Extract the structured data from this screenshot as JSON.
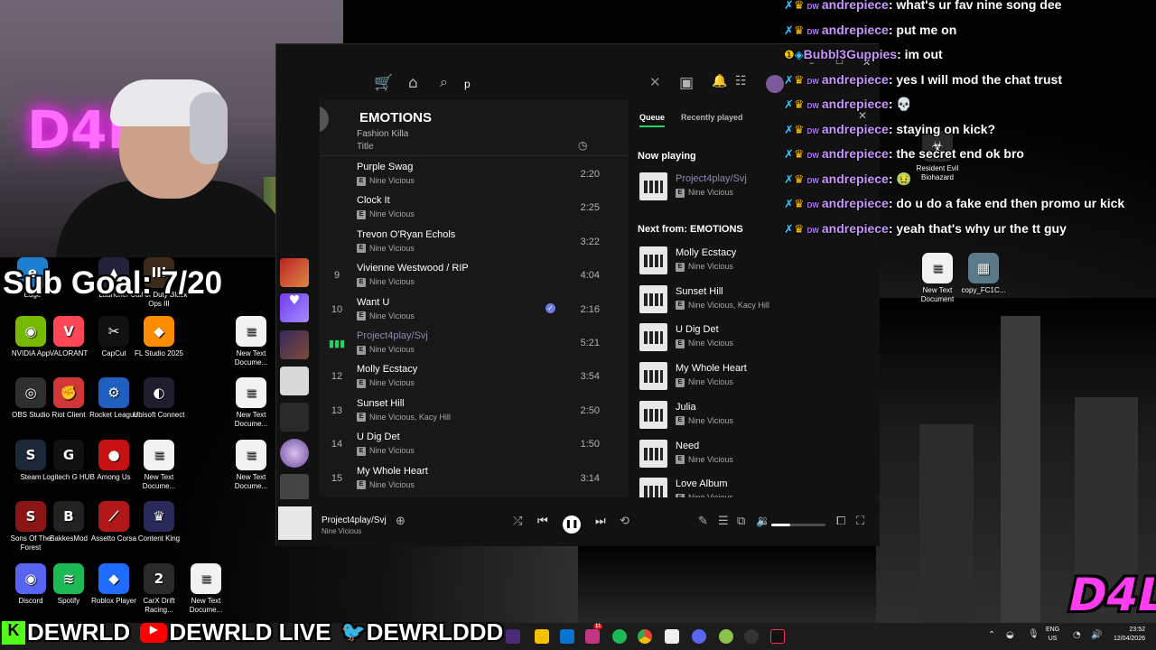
{
  "overlay": {
    "sub_goal": "Sub Goal: 7/20",
    "brand_logo": "D4L",
    "socials": [
      "DEWRLD",
      "DEWRLD LIVE",
      "DEWRLDDD"
    ]
  },
  "desktop_icons": [
    {
      "label": "Edge",
      "glyph": "e",
      "color": "#1b7ecf"
    },
    {
      "label": "Launcher",
      "glyph": "▲",
      "color": "#22223a"
    },
    {
      "label": "Call of Duty Black Ops III",
      "glyph": "III",
      "color": "#3a2a1a"
    },
    {
      "label": "NVIDIA App",
      "glyph": "◉",
      "color": "#76b900"
    },
    {
      "label": "VALORANT",
      "glyph": "V",
      "color": "#ff4655"
    },
    {
      "label": "CapCut",
      "glyph": "✂",
      "color": "#111111"
    },
    {
      "label": "FL Studio 2025",
      "glyph": "◆",
      "color": "#ff8c00"
    },
    {
      "label": "New Text Docume...",
      "glyph": "≡",
      "color": "#f2f2f2"
    },
    {
      "label": "OBS Studio",
      "glyph": "◎",
      "color": "#302e31"
    },
    {
      "label": "Riot Client",
      "glyph": "✊",
      "color": "#d13639"
    },
    {
      "label": "Rocket League",
      "glyph": "⚙",
      "color": "#1f5fbf"
    },
    {
      "label": "Ubisoft Connect",
      "glyph": "◐",
      "color": "#1e1e2e"
    },
    {
      "label": "New Text Docume...",
      "glyph": "≡",
      "color": "#f2f2f2"
    },
    {
      "label": "Steam",
      "glyph": "S",
      "color": "#1b2838"
    },
    {
      "label": "Logitech G HUB",
      "glyph": "G",
      "color": "#111111"
    },
    {
      "label": "Among Us",
      "glyph": "●",
      "color": "#c51111"
    },
    {
      "label": "New Text Docume...",
      "glyph": "≡",
      "color": "#f2f2f2"
    },
    {
      "label": "New Text Docume...",
      "glyph": "≡",
      "color": "#f2f2f2"
    },
    {
      "label": "Sons Of The Forest",
      "glyph": "S",
      "color": "#8b1414"
    },
    {
      "label": "BakkesMod",
      "glyph": "B",
      "color": "#222222"
    },
    {
      "label": "Assetto Corsa",
      "glyph": "⟋",
      "color": "#b01818"
    },
    {
      "label": "Content King",
      "glyph": "♛",
      "color": "#2a2a5a"
    },
    {
      "label": "Discord",
      "glyph": "◉",
      "color": "#5865f2"
    },
    {
      "label": "Spotify",
      "glyph": "≋",
      "color": "#1db954"
    },
    {
      "label": "Roblox Player",
      "glyph": "◆",
      "color": "#1e6cff"
    },
    {
      "label": "CarX Drift Racing...",
      "glyph": "2",
      "color": "#2a2a2a"
    },
    {
      "label": "New Text Docume...",
      "glyph": "≡",
      "color": "#f2f2f2"
    },
    {
      "label": "Resident Evil Biohazard",
      "glyph": "☣",
      "color": "#2a2a2a"
    },
    {
      "label": "New Text Document",
      "glyph": "≡",
      "color": "#f2f2f2"
    },
    {
      "label": "copy_FC1C...",
      "glyph": "▦",
      "color": "#5a7a8a"
    }
  ],
  "spotify": {
    "search_value": "p",
    "playlist_title": "EMOTIONS",
    "playlist_subtitle": "Fashion Killa",
    "column_title": "Title",
    "tracks": [
      {
        "num": "",
        "title": "Purple Swag",
        "artist": "Nine Vicious",
        "duration": "2:20",
        "playing": false,
        "liked": false
      },
      {
        "num": "",
        "title": "Clock It",
        "artist": "Nine Vicious",
        "duration": "2:25",
        "playing": false,
        "liked": false
      },
      {
        "num": "",
        "title": "Trevon O'Ryan Echols",
        "artist": "Nine Vicious",
        "duration": "3:22",
        "playing": false,
        "liked": false
      },
      {
        "num": "9",
        "title": "Vivienne Westwood / RIP",
        "artist": "Nine Vicious",
        "duration": "4:04",
        "playing": false,
        "liked": false
      },
      {
        "num": "10",
        "title": "Want U",
        "artist": "Nine Vicious",
        "duration": "2:16",
        "playing": false,
        "liked": true
      },
      {
        "num": "",
        "title": "Project4play/Svj",
        "artist": "Nine Vicious",
        "duration": "5:21",
        "playing": true,
        "liked": false
      },
      {
        "num": "12",
        "title": "Molly Ecstacy",
        "artist": "Nine Vicious",
        "duration": "3:54",
        "playing": false,
        "liked": false
      },
      {
        "num": "13",
        "title": "Sunset Hill",
        "artist": "Nine Vicious, Kacy Hill",
        "duration": "2:50",
        "playing": false,
        "liked": false
      },
      {
        "num": "14",
        "title": "U Dig Det",
        "artist": "Nine Vicious",
        "duration": "1:50",
        "playing": false,
        "liked": false
      },
      {
        "num": "15",
        "title": "My Whole Heart",
        "artist": "Nine Vicious",
        "duration": "3:14",
        "playing": false,
        "liked": false
      }
    ],
    "queue": {
      "tab_queue": "Queue",
      "tab_recent": "Recently played",
      "now_playing_heading": "Now playing",
      "now_playing": {
        "title": "Project4play/Svj",
        "artist": "Nine Vicious"
      },
      "next_heading": "Next from: EMOTIONS",
      "next": [
        {
          "title": "Molly Ecstacy",
          "artist": "Nine Vicious"
        },
        {
          "title": "Sunset Hill",
          "artist": "Nine Vicious, Kacy Hill"
        },
        {
          "title": "U Dig Det",
          "artist": "Nine Vicious"
        },
        {
          "title": "My Whole Heart",
          "artist": "Nine Vicious"
        },
        {
          "title": "Julia",
          "artist": "Nine Vicious"
        },
        {
          "title": "Need",
          "artist": "Nine Vicious"
        },
        {
          "title": "Love Album",
          "artist": "Nine Vicious"
        }
      ]
    },
    "player": {
      "title": "Project4play/Svj",
      "artist": "Nine Vicious",
      "progress": 0.09,
      "volume": 0.35
    }
  },
  "chat": [
    {
      "user": "andrepiece",
      "badge": "crown",
      "message": "what's ur fav nine song dee"
    },
    {
      "user": "andrepiece",
      "badge": "crown",
      "message": "put me on"
    },
    {
      "user": "Bubbl3Guppies",
      "badge": "cube",
      "message": "im out"
    },
    {
      "user": "andrepiece",
      "badge": "crown",
      "message": "yes I will mod the chat trust"
    },
    {
      "user": "andrepiece",
      "badge": "crown",
      "message": "💀"
    },
    {
      "user": "andrepiece",
      "badge": "crown",
      "message": "staying on kick?"
    },
    {
      "user": "andrepiece",
      "badge": "crown",
      "message": "the secret end ok bro"
    },
    {
      "user": "andrepiece",
      "badge": "crown",
      "message": "🤢"
    },
    {
      "user": "andrepiece",
      "badge": "crown",
      "message": "do u do a fake end then promo ur kick"
    },
    {
      "user": "andrepiece",
      "badge": "crown",
      "message": "yeah that's why ur the tt guy"
    }
  ],
  "chat_badge_text": "DW",
  "taskbar": {
    "lang_top": "ENG",
    "lang_bottom": "US",
    "time": "23:52",
    "date": "12/04/2026",
    "notif_count": "11"
  }
}
